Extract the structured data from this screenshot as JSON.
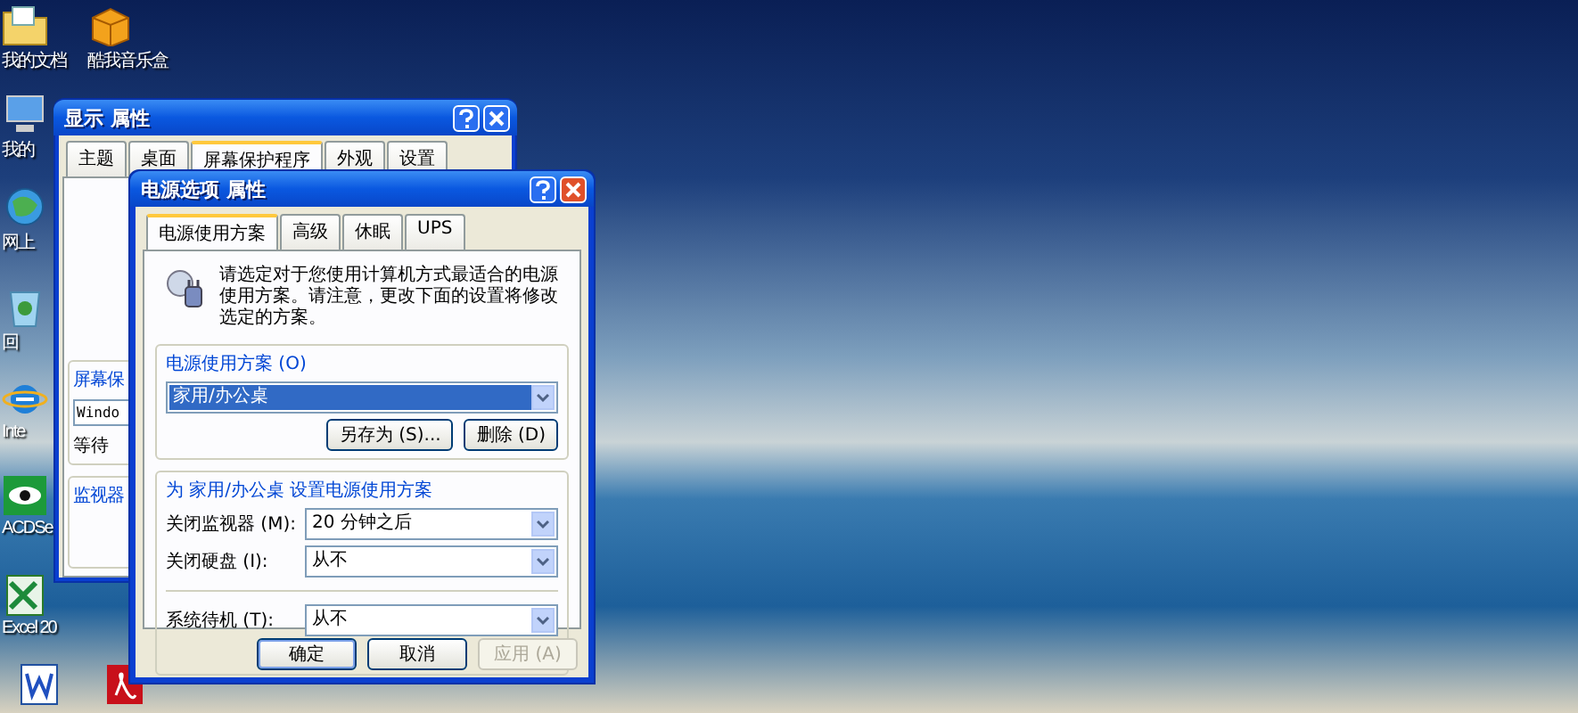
{
  "desktop_icons": [
    {
      "label": "我的文档",
      "kind": "folder"
    },
    {
      "label": "酷我音乐盒",
      "kind": "music"
    },
    {
      "label": "我的",
      "kind": "computer"
    },
    {
      "label": "网上",
      "kind": "network"
    },
    {
      "label": "回",
      "kind": "recycle"
    },
    {
      "label": "Inte",
      "kind": "browser"
    },
    {
      "label": "ACDSe",
      "kind": "viewer"
    },
    {
      "label": "Excel 20",
      "kind": "sheet"
    },
    {
      "kind": "word"
    },
    {
      "kind": "pdf"
    }
  ],
  "back_dialog": {
    "title": "显示 属性",
    "tabs": [
      {
        "label": "主题",
        "selected": false
      },
      {
        "label": "桌面",
        "selected": false
      },
      {
        "label": "屏幕保护程序",
        "selected": true
      },
      {
        "label": "外观",
        "selected": false
      },
      {
        "label": "设置",
        "selected": false
      }
    ],
    "group_label": "屏幕保",
    "screensaver_value": "Windo",
    "wait_label": "等待",
    "monitor_group_label": "监视器"
  },
  "dialog": {
    "title": "电源选项 属性",
    "tabs": [
      {
        "label": "电源使用方案",
        "selected": true
      },
      {
        "label": "高级",
        "selected": false
      },
      {
        "label": "休眠",
        "selected": false
      },
      {
        "label": "UPS",
        "selected": false
      }
    ],
    "description": "请选定对于您使用计算机方式最适合的电源使用方案。请注意，更改下面的设置将修改选定的方案。",
    "scheme_group": "电源使用方案 (O)",
    "scheme_value": "家用/办公桌",
    "scheme_buttons": [
      "另存为 (S)...",
      "删除 (D)"
    ],
    "settings_group": "为 家用/办公桌 设置电源使用方案",
    "settings_sections": [
      [
        {
          "label": "关闭监视器 (M):",
          "value": "20 分钟之后"
        },
        {
          "label": "关闭硬盘 (I):",
          "value": "从不"
        }
      ],
      [
        {
          "label": "系统待机 (T):",
          "value": "从不"
        }
      ]
    ],
    "buttons": [
      {
        "label": "确定",
        "disabled": false,
        "default": true
      },
      {
        "label": "取消",
        "disabled": false,
        "default": false
      },
      {
        "label": "应用 (A)",
        "disabled": true,
        "default": false
      }
    ]
  }
}
